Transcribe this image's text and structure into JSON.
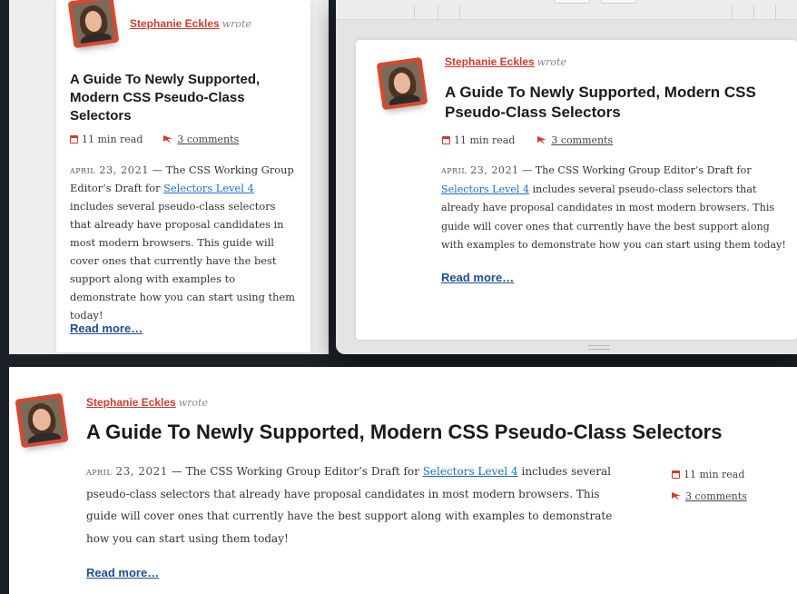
{
  "article": {
    "author": "Stephanie Eckles",
    "wrote": "wrote",
    "title": "A Guide To Newly Supported, Modern CSS Pseudo-Class Selectors",
    "read_time": "11 min read",
    "comments": "3 comments",
    "date": "April 23, 2021",
    "dash": " — ",
    "excerpt_before_link": "The CSS Working Group Editor’s Draft for ",
    "excerpt_link": "Selectors Level 4",
    "excerpt_after_link": " includes several pseudo-class selectors that already have proposal candidates in most modern browsers. This guide will cover ones that currently have the best support along with examples to demonstrate how you can start using them today!",
    "read_more": "Read more…"
  },
  "colors": {
    "accent": "#d33a2c",
    "link": "#1d6ec7",
    "read_more": "#1d4f91",
    "background": "#1c2127"
  },
  "icons": {
    "avatar": "author-avatar",
    "calendar": "calendar-icon",
    "comments": "comment-icon"
  }
}
